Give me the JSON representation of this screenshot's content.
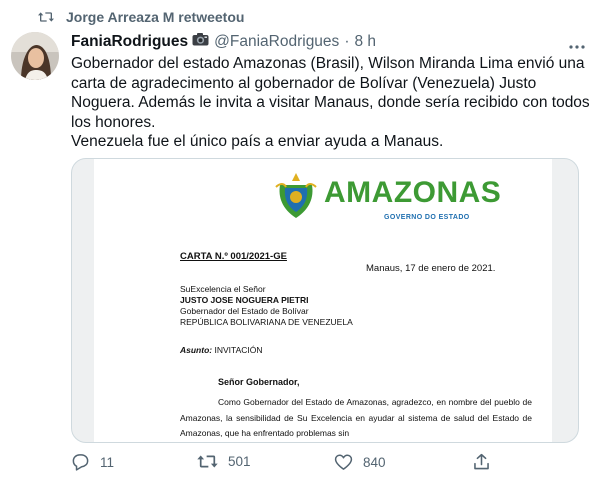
{
  "retweet": {
    "text": "Jorge Arreaza M retweetou"
  },
  "author": {
    "name": "FaniaRodrigues",
    "handle": "@FaniaRodrigues",
    "separator": "·",
    "time": "8 h"
  },
  "tweet": {
    "line1": "Gobernador del estado Amazonas (Brasil), Wilson Miranda Lima envió una carta de agradecimento al gobernador de Bolívar (Venezuela) Justo Noguera. Además le invita a visitar Manaus, donde sería recibido con todos los honores.",
    "line2": "Venezuela fue el único país a enviar ayuda a Manaus."
  },
  "document": {
    "logo_title": "AMAZONAS",
    "logo_subtitle": "GOVERNO DO ESTADO",
    "reference": "CARTA N.º 001/2021-GE",
    "date": "Manaus, 17 de enero de 2021.",
    "salutation": "SuExcelencia el Señor",
    "recipient_name": "JUSTO JOSE NOGUERA PIETRI",
    "recipient_role": "Gobernador del Estado de Bolívar",
    "recipient_country": "REPÚBLICA BOLIVARIANA DE VENEZUELA",
    "subject_label": "Asunto:",
    "subject_value": " INVITACIÓN",
    "greeting": "Señor Gobernador,",
    "body": "Como Gobernador del Estado de Amazonas, agradezco, en nombre del pueblo de Amazonas, la sensibilidad de Su Excelencia en ayudar al sistema de salud del Estado de Amazonas, que ha enfrentado problemas sin"
  },
  "actions": {
    "replies": "11",
    "retweets": "501",
    "likes": "840"
  },
  "icons": {
    "retweet_header": "retweet-icon",
    "camera": "camera-icon",
    "more": "more-icon",
    "reply": "reply-icon",
    "retweet": "retweet-icon",
    "like": "heart-icon",
    "share": "share-icon"
  },
  "colors": {
    "secondary_text": "#536471",
    "logo_green": "#3d9a34",
    "logo_blue": "#1f6fb0"
  }
}
